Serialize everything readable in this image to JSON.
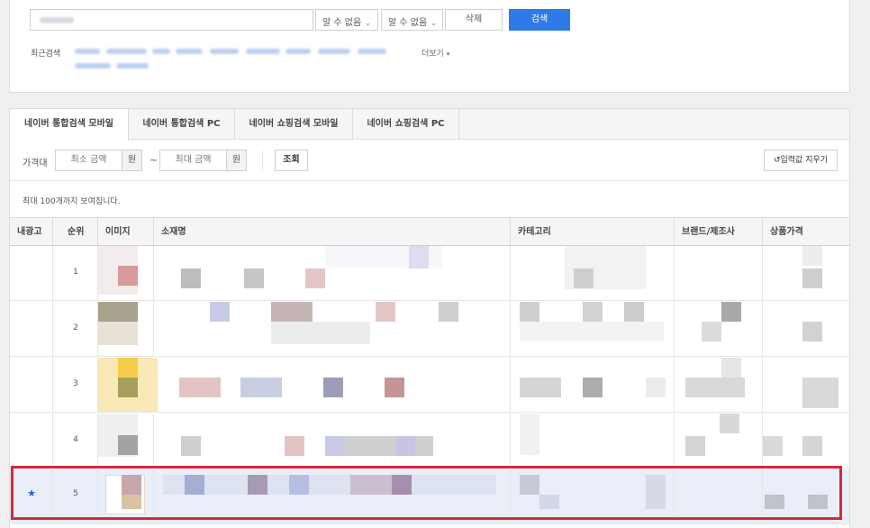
{
  "search": {
    "select1": "알 수 없음",
    "select2": "알 수 없음",
    "delete_label": "삭제",
    "search_label": "검색",
    "recent_label": "최근검색",
    "more_label": "더보기"
  },
  "tabs": [
    {
      "label": "네이버 통합검색 모바일",
      "active": true
    },
    {
      "label": "네이버 통합검색 PC",
      "active": false
    },
    {
      "label": "네이버 쇼핑검색 모바일",
      "active": false
    },
    {
      "label": "네이버 쇼핑검색 PC",
      "active": false
    }
  ],
  "filter": {
    "label": "가격대",
    "min_placeholder": "최소 금액",
    "max_placeholder": "최대 금액",
    "currency": "원",
    "tilde": "~",
    "query_label": "조회",
    "clear_label": "입력값 지우기"
  },
  "note": "최대 100개까지 보여집니다.",
  "table": {
    "columns": [
      "내광고",
      "순위",
      "이미지",
      "소재명",
      "카테고리",
      "브랜드/제조사",
      "상품가격"
    ],
    "rows": [
      {
        "mine": "",
        "rank": "1"
      },
      {
        "mine": "",
        "rank": "2"
      },
      {
        "mine": "",
        "rank": "3"
      },
      {
        "mine": "",
        "rank": "4"
      },
      {
        "mine": "★",
        "rank": "5"
      }
    ]
  },
  "colors": {
    "accent": "#2e7ae6",
    "highlight_border": "#d7263d",
    "star": "#2d5ad8"
  }
}
